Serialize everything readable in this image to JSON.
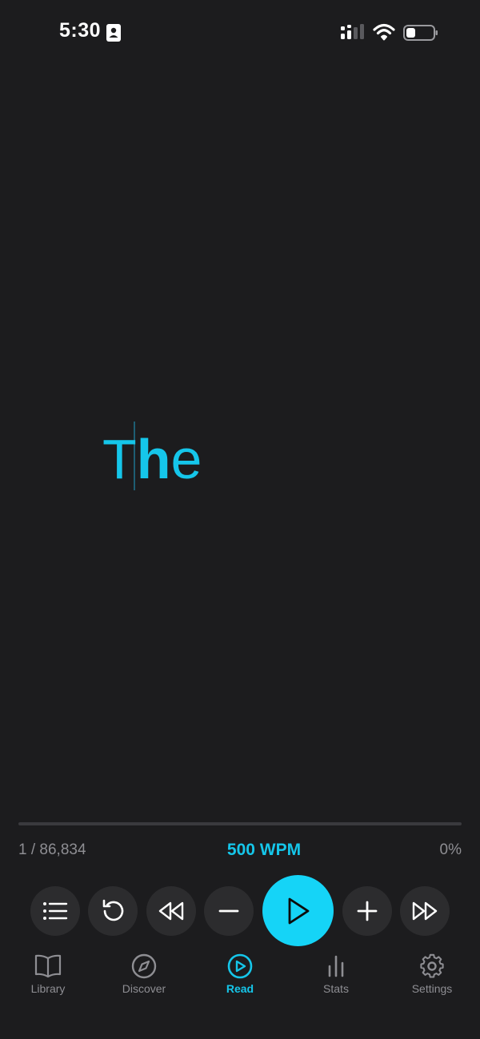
{
  "status_bar": {
    "time": "5:30",
    "icons": [
      "contact-card-icon",
      "cellular-signal-icon",
      "wifi-icon",
      "battery-icon"
    ]
  },
  "reader": {
    "word_before_pivot": "T",
    "word_pivot": "h",
    "word_after_pivot": "e",
    "word_color": "#15c6ea"
  },
  "progress": {
    "position": "1 / 86,834",
    "wpm": "500 WPM",
    "percent": "0%",
    "fraction": 0
  },
  "controls": [
    {
      "name": "chapters-button",
      "icon": "list-icon"
    },
    {
      "name": "restart-button",
      "icon": "rotate-ccw-icon"
    },
    {
      "name": "rewind-button",
      "icon": "rewind-icon"
    },
    {
      "name": "decrease-speed-button",
      "icon": "minus-icon"
    },
    {
      "name": "play-button",
      "icon": "play-icon"
    },
    {
      "name": "increase-speed-button",
      "icon": "plus-icon"
    },
    {
      "name": "fast-forward-button",
      "icon": "fast-forward-icon"
    }
  ],
  "tabs": [
    {
      "label": "Library",
      "icon": "book-icon",
      "active": false
    },
    {
      "label": "Discover",
      "icon": "compass-icon",
      "active": false
    },
    {
      "label": "Read",
      "icon": "play-circle-icon",
      "active": true
    },
    {
      "label": "Stats",
      "icon": "bar-chart-icon",
      "active": false
    },
    {
      "label": "Settings",
      "icon": "gear-icon",
      "active": false
    }
  ],
  "colors": {
    "accent": "#15c6ea",
    "background": "#1c1c1e",
    "control_background": "#2c2c2e",
    "muted_text": "#8e8e93"
  }
}
